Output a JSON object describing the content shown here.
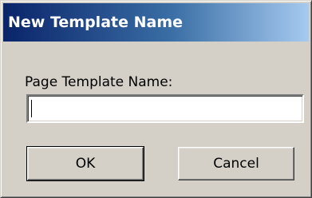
{
  "window": {
    "title": "New Template Name"
  },
  "form": {
    "label": "Page Template Name:",
    "input_value": ""
  },
  "buttons": {
    "ok_label": "OK",
    "cancel_label": "Cancel"
  },
  "colors": {
    "titlebar_start": "#0a246a",
    "titlebar_end": "#a6caf0",
    "face": "#d4d0c8"
  }
}
